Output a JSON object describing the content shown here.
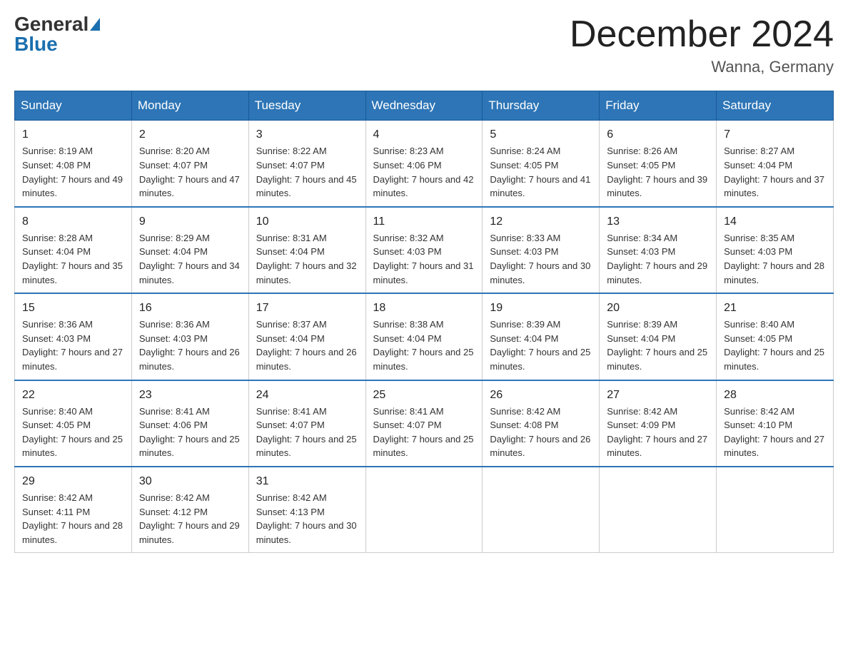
{
  "logo": {
    "general": "General",
    "blue": "Blue"
  },
  "title": "December 2024",
  "subtitle": "Wanna, Germany",
  "headers": [
    "Sunday",
    "Monday",
    "Tuesday",
    "Wednesday",
    "Thursday",
    "Friday",
    "Saturday"
  ],
  "weeks": [
    [
      {
        "day": "1",
        "sunrise": "8:19 AM",
        "sunset": "4:08 PM",
        "daylight": "7 hours and 49 minutes."
      },
      {
        "day": "2",
        "sunrise": "8:20 AM",
        "sunset": "4:07 PM",
        "daylight": "7 hours and 47 minutes."
      },
      {
        "day": "3",
        "sunrise": "8:22 AM",
        "sunset": "4:07 PM",
        "daylight": "7 hours and 45 minutes."
      },
      {
        "day": "4",
        "sunrise": "8:23 AM",
        "sunset": "4:06 PM",
        "daylight": "7 hours and 42 minutes."
      },
      {
        "day": "5",
        "sunrise": "8:24 AM",
        "sunset": "4:05 PM",
        "daylight": "7 hours and 41 minutes."
      },
      {
        "day": "6",
        "sunrise": "8:26 AM",
        "sunset": "4:05 PM",
        "daylight": "7 hours and 39 minutes."
      },
      {
        "day": "7",
        "sunrise": "8:27 AM",
        "sunset": "4:04 PM",
        "daylight": "7 hours and 37 minutes."
      }
    ],
    [
      {
        "day": "8",
        "sunrise": "8:28 AM",
        "sunset": "4:04 PM",
        "daylight": "7 hours and 35 minutes."
      },
      {
        "day": "9",
        "sunrise": "8:29 AM",
        "sunset": "4:04 PM",
        "daylight": "7 hours and 34 minutes."
      },
      {
        "day": "10",
        "sunrise": "8:31 AM",
        "sunset": "4:04 PM",
        "daylight": "7 hours and 32 minutes."
      },
      {
        "day": "11",
        "sunrise": "8:32 AM",
        "sunset": "4:03 PM",
        "daylight": "7 hours and 31 minutes."
      },
      {
        "day": "12",
        "sunrise": "8:33 AM",
        "sunset": "4:03 PM",
        "daylight": "7 hours and 30 minutes."
      },
      {
        "day": "13",
        "sunrise": "8:34 AM",
        "sunset": "4:03 PM",
        "daylight": "7 hours and 29 minutes."
      },
      {
        "day": "14",
        "sunrise": "8:35 AM",
        "sunset": "4:03 PM",
        "daylight": "7 hours and 28 minutes."
      }
    ],
    [
      {
        "day": "15",
        "sunrise": "8:36 AM",
        "sunset": "4:03 PM",
        "daylight": "7 hours and 27 minutes."
      },
      {
        "day": "16",
        "sunrise": "8:36 AM",
        "sunset": "4:03 PM",
        "daylight": "7 hours and 26 minutes."
      },
      {
        "day": "17",
        "sunrise": "8:37 AM",
        "sunset": "4:04 PM",
        "daylight": "7 hours and 26 minutes."
      },
      {
        "day": "18",
        "sunrise": "8:38 AM",
        "sunset": "4:04 PM",
        "daylight": "7 hours and 25 minutes."
      },
      {
        "day": "19",
        "sunrise": "8:39 AM",
        "sunset": "4:04 PM",
        "daylight": "7 hours and 25 minutes."
      },
      {
        "day": "20",
        "sunrise": "8:39 AM",
        "sunset": "4:04 PM",
        "daylight": "7 hours and 25 minutes."
      },
      {
        "day": "21",
        "sunrise": "8:40 AM",
        "sunset": "4:05 PM",
        "daylight": "7 hours and 25 minutes."
      }
    ],
    [
      {
        "day": "22",
        "sunrise": "8:40 AM",
        "sunset": "4:05 PM",
        "daylight": "7 hours and 25 minutes."
      },
      {
        "day": "23",
        "sunrise": "8:41 AM",
        "sunset": "4:06 PM",
        "daylight": "7 hours and 25 minutes."
      },
      {
        "day": "24",
        "sunrise": "8:41 AM",
        "sunset": "4:07 PM",
        "daylight": "7 hours and 25 minutes."
      },
      {
        "day": "25",
        "sunrise": "8:41 AM",
        "sunset": "4:07 PM",
        "daylight": "7 hours and 25 minutes."
      },
      {
        "day": "26",
        "sunrise": "8:42 AM",
        "sunset": "4:08 PM",
        "daylight": "7 hours and 26 minutes."
      },
      {
        "day": "27",
        "sunrise": "8:42 AM",
        "sunset": "4:09 PM",
        "daylight": "7 hours and 27 minutes."
      },
      {
        "day": "28",
        "sunrise": "8:42 AM",
        "sunset": "4:10 PM",
        "daylight": "7 hours and 27 minutes."
      }
    ],
    [
      {
        "day": "29",
        "sunrise": "8:42 AM",
        "sunset": "4:11 PM",
        "daylight": "7 hours and 28 minutes."
      },
      {
        "day": "30",
        "sunrise": "8:42 AM",
        "sunset": "4:12 PM",
        "daylight": "7 hours and 29 minutes."
      },
      {
        "day": "31",
        "sunrise": "8:42 AM",
        "sunset": "4:13 PM",
        "daylight": "7 hours and 30 minutes."
      },
      null,
      null,
      null,
      null
    ]
  ]
}
